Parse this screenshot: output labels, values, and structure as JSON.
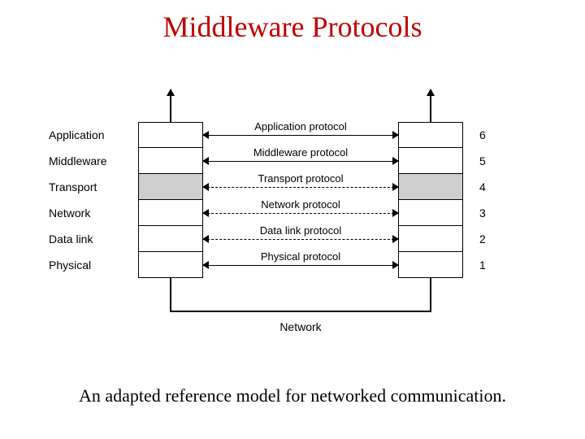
{
  "title": "Middleware Protocols",
  "caption": "An adapted reference model for networked communication.",
  "network_label": "Network",
  "layers": [
    {
      "name": "Application",
      "number": "6",
      "protocol": "Application protocol",
      "dashed": false,
      "shaded": false
    },
    {
      "name": "Middleware",
      "number": "5",
      "protocol": "Middleware protocol",
      "dashed": false,
      "shaded": false
    },
    {
      "name": "Transport",
      "number": "4",
      "protocol": "Transport protocol",
      "dashed": true,
      "shaded": true
    },
    {
      "name": "Network",
      "number": "3",
      "protocol": "Network protocol",
      "dashed": true,
      "shaded": false
    },
    {
      "name": "Data link",
      "number": "2",
      "protocol": "Data link protocol",
      "dashed": true,
      "shaded": false
    },
    {
      "name": "Physical",
      "number": "1",
      "protocol": "Physical protocol",
      "dashed": false,
      "shaded": false
    }
  ]
}
